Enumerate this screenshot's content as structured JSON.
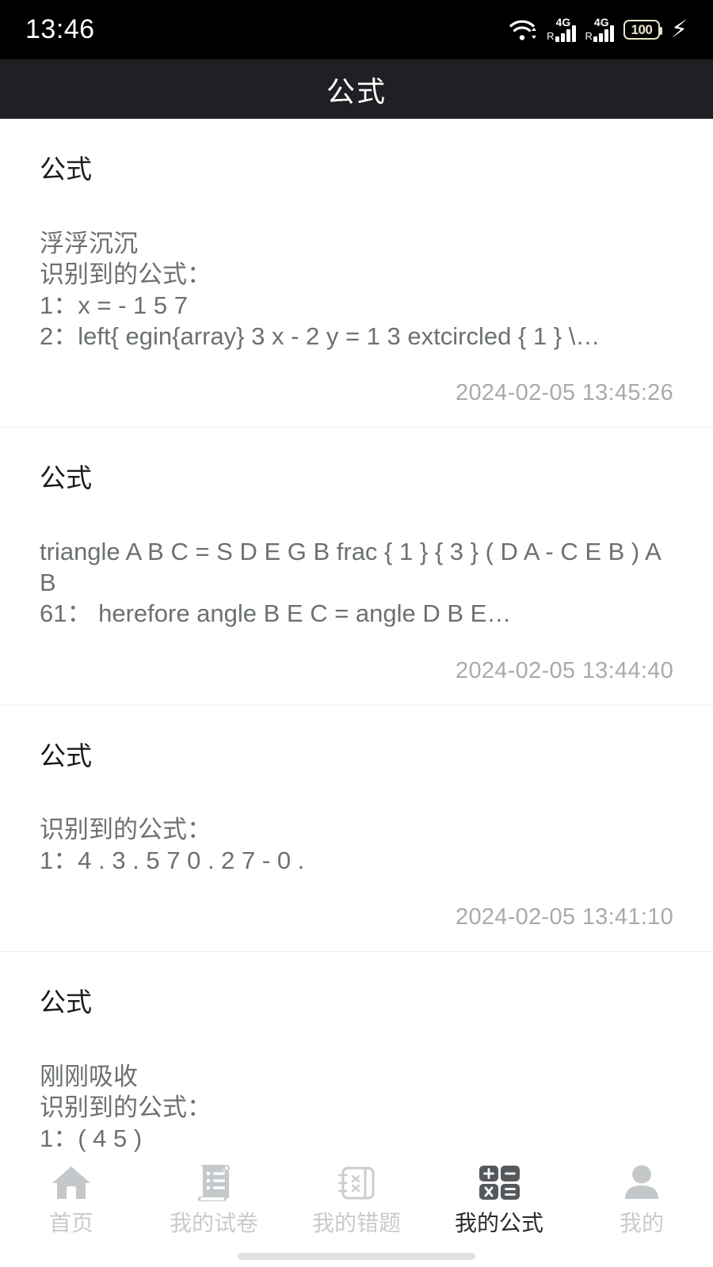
{
  "status_bar": {
    "time": "13:46",
    "wifi_icon": "wifi-icon",
    "signal_1_label": "4G",
    "signal_1_roaming": "R",
    "signal_2_label": "4G",
    "signal_2_roaming": "R",
    "battery_level": "100",
    "charging_icon": "charging-bolt-icon"
  },
  "header": {
    "title": "公式"
  },
  "cards": [
    {
      "title": "公式",
      "body": "浮浮沉沉\n识别到的公式：\n1：x = - 1 5   7\n2：left{  egin{array} 3 x - 2 y = 1 3   extcircled { 1 } \\…",
      "time": "2024-02-05 13:45:26"
    },
    {
      "title": "公式",
      "body": "triangle A B C = S D E G B frac { 1 } { 3 } ( D A - C E B ) A B\n61：  herefore angle B E C = angle D B E…",
      "time": "2024-02-05 13:44:40"
    },
    {
      "title": "公式",
      "body": "识别到的公式：\n1：4 . 3 . 5 7   0 . 2 7 - 0 .",
      "time": "2024-02-05 13:41:10"
    },
    {
      "title": "公式",
      "body": "刚刚吸收\n识别到的公式：\n1：( 4 5 )",
      "time": ""
    }
  ],
  "tabbar": {
    "items": [
      {
        "label": "首页",
        "icon": "home-icon",
        "active": false
      },
      {
        "label": "我的试卷",
        "icon": "scroll-icon",
        "active": false
      },
      {
        "label": "我的错题",
        "icon": "notebook-icon",
        "active": false
      },
      {
        "label": "我的公式",
        "icon": "calculator-icon",
        "active": true
      },
      {
        "label": "我的",
        "icon": "person-icon",
        "active": false
      }
    ]
  },
  "colors": {
    "status_bar_bg": "#000000",
    "header_bg": "#1e2023",
    "page_bg": "#ffffff",
    "card_title": "#1a1a1a",
    "card_body": "#6b7073",
    "card_time": "#a6abae",
    "tab_inactive": "#c8cbcd",
    "tab_active": "#2b2b2b",
    "divider": "#eceef0",
    "battery_outline": "#e8e4c8"
  }
}
